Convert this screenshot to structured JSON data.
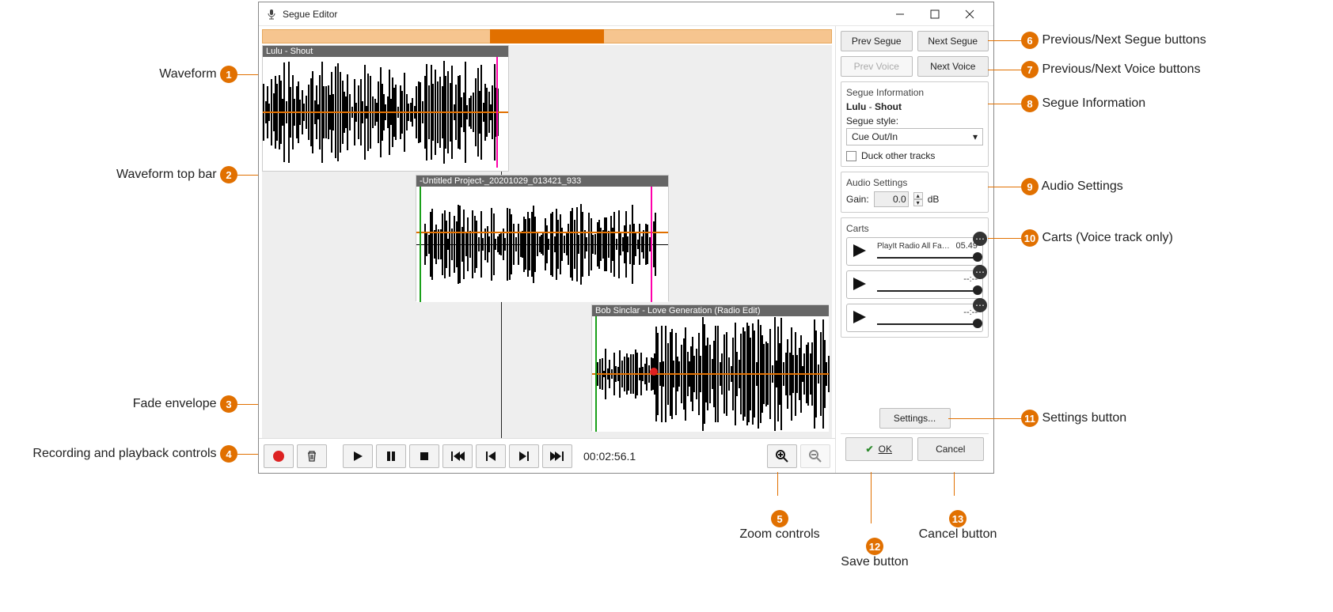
{
  "window": {
    "title": "Segue Editor"
  },
  "overview": {
    "segment_left_pct": 40,
    "segment_width_pct": 20
  },
  "tracks": [
    {
      "title": "Lulu - Shout"
    },
    {
      "title": "-Untitled Project-_20201029_013421_933"
    },
    {
      "title": "Bob Sinclar - Love Generation (Radio Edit)"
    }
  ],
  "transport": {
    "time": "00:02:56.1"
  },
  "nav": {
    "prev_segue": "Prev Segue",
    "next_segue": "Next Segue",
    "prev_voice": "Prev Voice",
    "next_voice": "Next Voice"
  },
  "segue_info": {
    "panel_title": "Segue Information",
    "artist": "Lulu",
    "sep": " - ",
    "track": "Shout",
    "style_label": "Segue style:",
    "style_value": "Cue Out/In",
    "duck_label": "Duck other tracks"
  },
  "audio_settings": {
    "panel_title": "Audio Settings",
    "gain_label": "Gain:",
    "gain_value": "0.0",
    "gain_unit": "dB"
  },
  "carts": {
    "panel_title": "Carts",
    "items": [
      {
        "name": "PlayIt Radio All Fa…",
        "time": "05.49"
      },
      {
        "name": "",
        "time": "--:--"
      },
      {
        "name": "",
        "time": "--:--"
      }
    ]
  },
  "settings_button": "Settings...",
  "ok_button": "OK",
  "cancel_button": "Cancel",
  "callouts": {
    "1": "Waveform",
    "2": "Waveform top bar",
    "3": "Fade envelope",
    "4": "Recording and playback controls",
    "5": "Zoom controls",
    "6": "Previous/Next Segue buttons",
    "7": "Previous/Next Voice buttons",
    "8": "Segue Information",
    "9": "Audio Settings",
    "10": "Carts (Voice track only)",
    "11": "Settings button",
    "12": "Save button",
    "13": "Cancel button"
  }
}
